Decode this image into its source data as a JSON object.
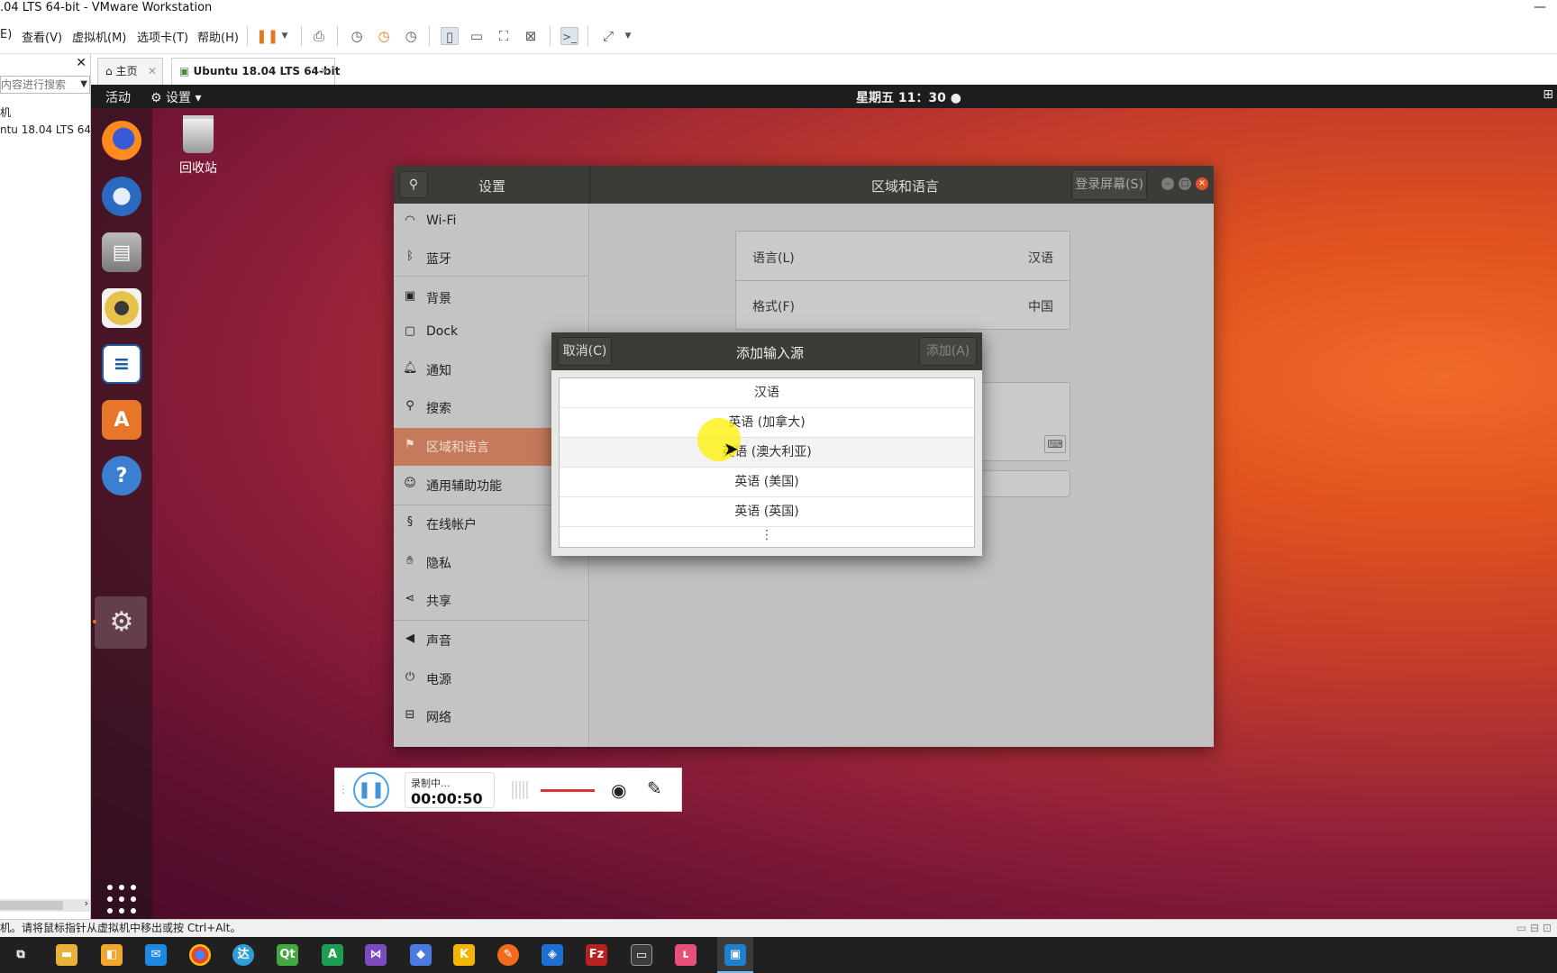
{
  "window": {
    "title": ".04 LTS 64-bit - VMware Workstation",
    "minimize": "—"
  },
  "menubar": {
    "items": [
      "E)",
      "查看(V)",
      "虚拟机(M)",
      "选项卡(T)",
      "帮助(H)"
    ]
  },
  "library": {
    "close": "✕",
    "search_placeholder": "内容进行搜索",
    "items": [
      "机",
      "ntu 18.04 LTS 64-b"
    ]
  },
  "tabs": [
    {
      "label": "主页",
      "close": "✕"
    },
    {
      "label": "Ubuntu 18.04 LTS 64-bit",
      "close": "✕"
    }
  ],
  "gnome": {
    "activities": "活动",
    "app_menu": "设置 ▾",
    "clock": "星期五 11：30 ●",
    "trash_label": "回收站"
  },
  "settings": {
    "sidebar_title": "设置",
    "panel_title": "区域和语言",
    "login_screen_button": "登录屏幕(S)",
    "items": [
      {
        "label": "Wi-Fi",
        "icon": "wifi-icon"
      },
      {
        "label": "蓝牙",
        "icon": "bluetooth-icon"
      },
      {
        "label": "背景",
        "icon": "background-icon"
      },
      {
        "label": "Dock",
        "icon": "dock-icon"
      },
      {
        "label": "通知",
        "icon": "bell-icon"
      },
      {
        "label": "搜索",
        "icon": "search-icon"
      },
      {
        "label": "区域和语言",
        "icon": "flag-icon",
        "selected": true
      },
      {
        "label": "通用辅助功能",
        "icon": "accessibility-icon"
      },
      {
        "label": "在线帐户",
        "icon": "online-accounts-icon"
      },
      {
        "label": "隐私",
        "icon": "hand-icon"
      },
      {
        "label": "共享",
        "icon": "share-icon"
      },
      {
        "label": "声音",
        "icon": "speaker-icon"
      },
      {
        "label": "电源",
        "icon": "power-icon"
      },
      {
        "label": "网络",
        "icon": "network-icon"
      }
    ],
    "language_label": "语言(L)",
    "language_value": "汉语",
    "formats_label": "格式(F)",
    "formats_value": "中国"
  },
  "dialog": {
    "title": "添加输入源",
    "cancel": "取消(C)",
    "add": "添加(A)",
    "options": [
      "汉语",
      "英语 (加拿大)",
      "英语 (澳大利亚)",
      "英语 (美国)",
      "英语 (英国)"
    ],
    "more": "⋮"
  },
  "recorder": {
    "status": "录制中...",
    "time": "00:00:50"
  },
  "statusbar": {
    "text": "机。请将鼠标指针从虚拟机中移出或按 Ctrl+Alt。"
  },
  "colors": {
    "ubuntu_orange": "#e95420",
    "selected_item": "#c67a5c",
    "header_dark": "#3c3b37"
  }
}
